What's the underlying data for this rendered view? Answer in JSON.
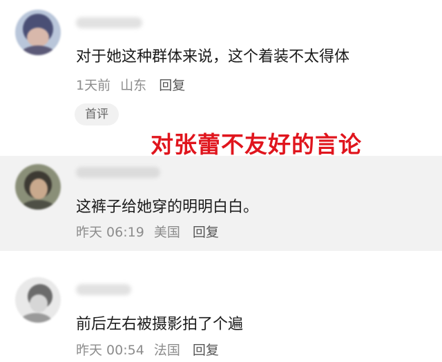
{
  "comments": [
    {
      "text": "对于她这种群体来说，这个着装不太得体",
      "time": "1天前",
      "location": "山东",
      "reply_label": "回复",
      "tag": "首评",
      "username_blurred": true
    },
    {
      "text": "这裤子给她穿的明明白白。",
      "time": "昨天 06:19",
      "location": "美国",
      "reply_label": "回复",
      "username_blurred": true
    },
    {
      "text": "前后左右被摄影拍了个遍",
      "time": "昨天 00:54",
      "location": "法国",
      "reply_label": "回复",
      "username_blurred": true
    }
  ],
  "annotation": {
    "text": "对张蕾不友好的言论",
    "color": "#e0151d"
  },
  "colors": {
    "highlight_background": "#f2f2f2",
    "meta_text": "#8c8c8c",
    "body_text": "#1a1a1a"
  },
  "icons": {
    "avatar_1": "blurred-avatar-dark-hair",
    "avatar_2": "blurred-avatar-face",
    "avatar_3": "blurred-avatar-light"
  }
}
